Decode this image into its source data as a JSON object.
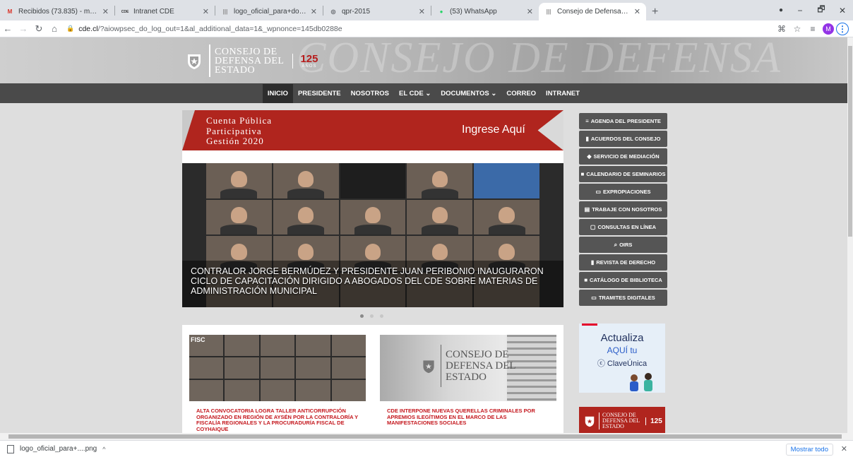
{
  "browser": {
    "tabs": [
      {
        "title": "Recibidos (73.835) - mo.schaffer...",
        "favicon": "M"
      },
      {
        "title": "Intranet CDE",
        "favicon": "CDE"
      },
      {
        "title": "logo_oficial_para+documentos_...",
        "favicon": "|||"
      },
      {
        "title": "qpr-2015",
        "favicon": "◎"
      },
      {
        "title": "(53) WhatsApp",
        "favicon": "●"
      },
      {
        "title": "Consejo de Defensa del Estado",
        "favicon": "|||"
      }
    ],
    "new_tab": "+",
    "window_controls": {
      "minimize": "−",
      "maximize": "🗗",
      "close": "✕"
    },
    "url_host": "cde.cl",
    "url_path": "/?aiowpsec_do_log_out=1&al_additional_data=1&_wpnonce=145db0288e",
    "avatar_letter": "M"
  },
  "header": {
    "logo_lines": [
      "CONSEJO DE",
      "DEFENSA DEL",
      "ESTADO"
    ],
    "anniversary_number": "125",
    "anniversary_label": "AÑOS",
    "watermark": "CONSEJO DE DEFENSA"
  },
  "nav": {
    "items": [
      "INICIO",
      "PRESIDENTE",
      "NOSOTROS",
      "EL CDE ⌄",
      "DOCUMENTOS ⌄",
      "CORREO",
      "INTRANET"
    ]
  },
  "cuenta": {
    "lines": [
      "Cuenta Pública",
      "Participativa",
      "Gestión 2020"
    ],
    "cta": "Ingrese Aquí"
  },
  "carousel": {
    "caption": "CONTRALOR JORGE BERMÚDEZ Y PRESIDENTE JUAN PERIBONIO INAUGURARON CICLO DE CAPACITACIÓN DIRIGIDO A ABOGADOS DEL CDE SOBRE MATERIAS DE ADMINISTRACIÓN MUNICIPAL",
    "slide_count": 3,
    "active_slide": 1
  },
  "news": [
    {
      "title": "ALTA CONVOCATORIA LOGRA TALLER ANTICORRUPCIÓN ORGANIZADO EN REGIÓN DE AYSÉN POR LA CONTRALORÍA Y FISCALÍA REGIONALES Y LA PROCURADURÍA FISCAL DE COYHAIQUE",
      "badge": "FISC"
    },
    {
      "title": "CDE INTERPONE NUEVAS QUERELLAS CRIMINALES POR APREMIOS ILEGÍTIMOS EN EL MARCO DE LAS MANIFESTACIONES SOCIALES",
      "sign_lines": [
        "CONSEJO DE",
        "DEFENSA DEL",
        "ESTADO"
      ]
    }
  ],
  "sidebar": {
    "buttons": [
      {
        "icon": "≡",
        "label": "AGENDA DEL PRESIDENTE"
      },
      {
        "icon": "▮",
        "label": "ACUERDOS DEL CONSEJO"
      },
      {
        "icon": "◆",
        "label": "SERVICIO DE MEDIACIÓN"
      },
      {
        "icon": "■",
        "label": "CALENDARIO DE SEMINARIOS"
      },
      {
        "icon": "▭",
        "label": "EXPROPIACIONES"
      },
      {
        "icon": "▤",
        "label": "TRABAJE CON NOSOTROS"
      },
      {
        "icon": "▢",
        "label": "CONSULTAS EN LÍNEA"
      },
      {
        "icon": "⌕",
        "label": "OIRS"
      },
      {
        "icon": "▮",
        "label": "REVISTA DE DERECHO"
      },
      {
        "icon": "■",
        "label": "CATÁLOGO DE BIBLIOTECA"
      },
      {
        "icon": "▭",
        "label": "TRAMITES DIGITALES"
      }
    ],
    "clave": {
      "line1": "Actualiza",
      "line2": "AQUÍ tu",
      "line3": "ⓒ ClaveÚnica"
    },
    "footer_logo": {
      "lines": [
        "CONSEJO DE",
        "DEFENSA DEL",
        "ESTADO"
      ],
      "number": "125"
    }
  },
  "downloads": {
    "file": "logo_oficial_para+....png",
    "caret": "^",
    "show_all": "Mostrar todo",
    "close": "✕"
  },
  "colors": {
    "brand_red": "#b0251e",
    "nav_dark": "#4a4a4a",
    "sidebar_btn": "#555555",
    "news_red": "#c4161c"
  }
}
